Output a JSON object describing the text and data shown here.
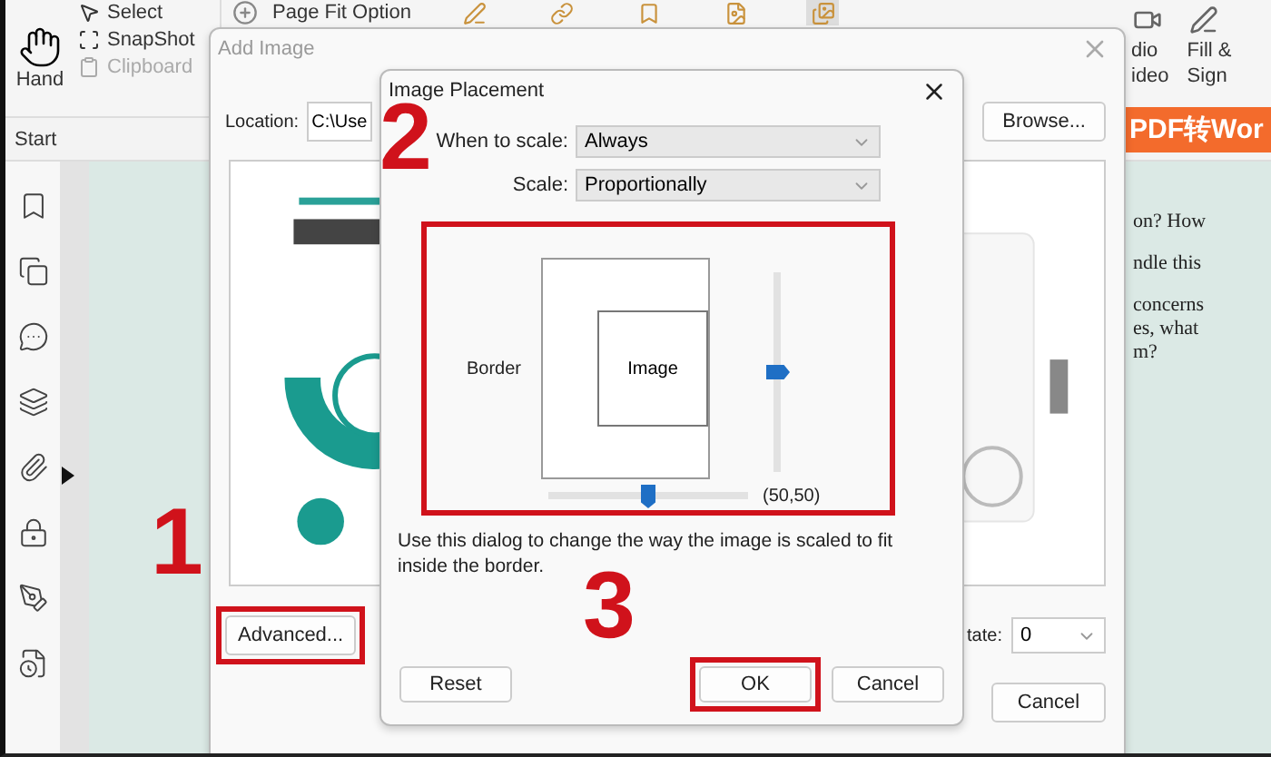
{
  "ribbon": {
    "hand": "Hand",
    "small_tools": [
      {
        "label": "Select",
        "disabled": false
      },
      {
        "label": "SnapShot",
        "disabled": false
      },
      {
        "label": "Clipboard",
        "disabled": true
      }
    ],
    "page_fit": "Page Fit Option",
    "media": [
      "dio",
      "ideo"
    ],
    "fill_sign": [
      "Fill &",
      "Sign"
    ]
  },
  "start_tab": "Start",
  "document": {
    "banner": "PDF转Wor",
    "paragraphs": [
      [
        "on? How"
      ],
      [
        "ndle this"
      ],
      [
        "concerns",
        "es, what",
        "m?"
      ]
    ]
  },
  "add_image": {
    "title": "Add Image",
    "location_label": "Location:",
    "location_value": "C:\\Use",
    "browse": "Browse...",
    "advanced": {
      "label": "Advanced...",
      "highlighted": true
    },
    "rotate_label": "tate:",
    "rotate_value": "0",
    "cancel": "Cancel"
  },
  "image_placement": {
    "title": "Image Placement",
    "fields": [
      {
        "label": "When to scale:",
        "value": "Always"
      },
      {
        "label": "Scale:",
        "value": "Proportionally"
      }
    ],
    "area_highlighted": true,
    "border_label": "Border",
    "image_label": "Image",
    "vertical_slider": {
      "level": 0.5
    },
    "horizontal_slider": {
      "level": 0.5
    },
    "position": "(50,50)",
    "description": "Use this dialog to change the way the image is scaled to fit inside the border.",
    "buttons": [
      {
        "label": "Reset",
        "highlighted": false
      },
      {
        "label": "OK",
        "highlighted": true
      },
      {
        "label": "Cancel",
        "highlighted": false
      }
    ]
  },
  "annotations": [
    {
      "label": "1"
    },
    {
      "label": "2"
    },
    {
      "label": "3"
    }
  ]
}
